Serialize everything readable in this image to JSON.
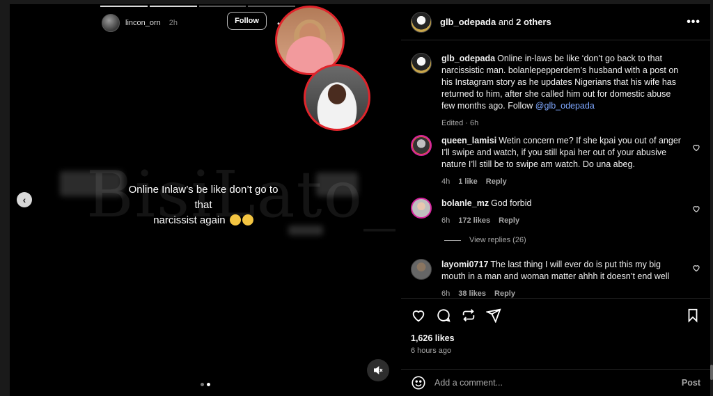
{
  "story": {
    "username": "lincon_orn",
    "time": "2h",
    "follow_label": "Follow",
    "more": "•••",
    "caption_line1": "Online Inlaw’s be like don’t go to that",
    "caption_line2": "narcissist again",
    "watermark": "BisiLato_"
  },
  "post": {
    "header_user": "glb_odepada",
    "header_and": "and",
    "header_others": "2 others",
    "author": "glb_odepada",
    "caption": "Online in-laws be like ‘don’t go back to that narcissistic man. bolanlepepperdem’s husband with a post on his Instagram story as he updates Nigerians that his wife has returned to him, after she called him out for domestic abuse few months ago. Follow",
    "mention": "@glb_odepada",
    "edited": "Edited · 6h",
    "likes": "1,626 likes",
    "time_ago": "6 hours ago"
  },
  "comments": [
    {
      "user": "queen_lamisi",
      "text": "Wetin concern me? If she kpai you out of anger I’ll swipe and watch, if you still kpai her out of your abusive nature I’ll still be to swipe am watch. Do una abeg.",
      "time": "4h",
      "likes": "1 like",
      "reply": "Reply"
    },
    {
      "user": "bolanle_mz",
      "text": "God forbid",
      "time": "6h",
      "likes": "172 likes",
      "reply": "Reply"
    },
    {
      "user": "layomi0717",
      "text": "The last thing I will ever do is put this my big mouth in a man and woman matter ahhh it doesn’t end well",
      "time": "6h",
      "likes": "38 likes",
      "reply": "Reply"
    }
  ],
  "view_replies": "View replies (26)",
  "add_comment": {
    "placeholder": "Add a comment...",
    "post_label": "Post"
  },
  "icons": [
    "chevron-left-icon",
    "mute-icon",
    "heart-icon",
    "comment-icon",
    "repost-icon",
    "share-icon",
    "bookmark-icon",
    "emoji-icon",
    "more-icon"
  ]
}
